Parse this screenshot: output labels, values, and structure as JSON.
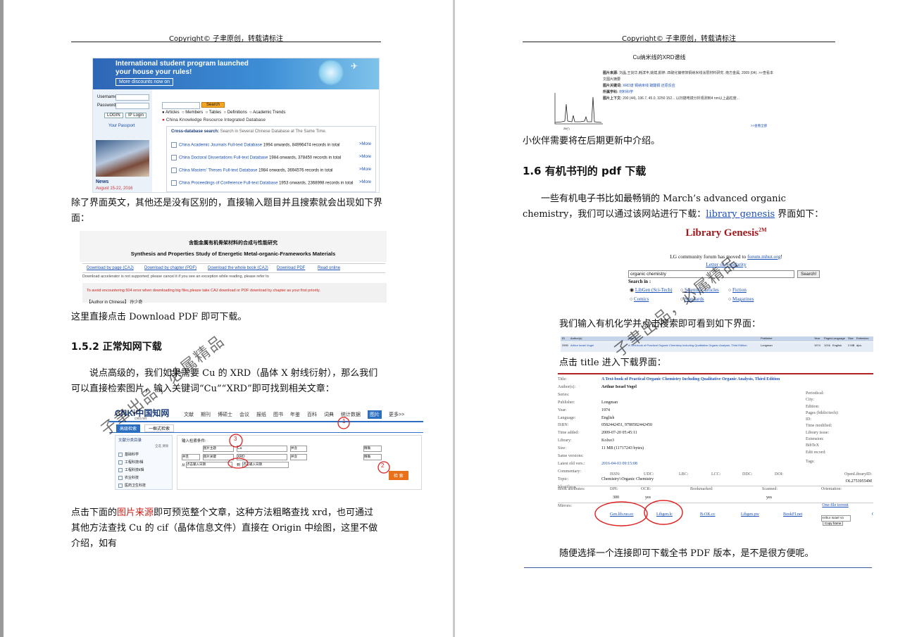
{
  "header": {
    "left": "Copyright© 子聿原创，转载请标注",
    "right": "Copyright© 子聿原创，转载请标注"
  },
  "watermark": {
    "left": "子聿出品，必属精品",
    "right": "子聿出品，必属精品"
  },
  "left": {
    "fig1": {
      "banner_title": "International student program launched",
      "banner_sub": "your house your rules!",
      "banner_btn": "More discounts now on",
      "username_label": "Username",
      "password_label": "Password",
      "login_btn": "LOGIN",
      "ip_login_btn": "IP Login",
      "passport": "Your Passport",
      "news": "News",
      "news_date": "August 15-22, 2016",
      "search_btn": "Search",
      "radios": [
        "Articles",
        "Members",
        "Tables",
        "Definitions",
        "Academic Trends"
      ],
      "section_title": "China Knowledge Resource Integrated Database",
      "cross_title": "Cross-database search:",
      "cross_desc": "Search in Several Chinese Database at The Same Time.",
      "rows": [
        {
          "name": "China Academic Journals Full-text Database",
          "info": "1994 onwards, 84996474 records in total",
          "more": ">More"
        },
        {
          "name": "China Doctoral Dissertations Full-text Database",
          "info": "1984 onwards, 378450 records in total",
          "more": ">More"
        },
        {
          "name": "China Masters' Theses Full-text Database",
          "info": "1984 onwards, 3694576 records in total",
          "more": ">More"
        },
        {
          "name": "China Proceedings of Conference Full-text Database",
          "info": "1953 onwards, 2368998 records in total",
          "more": ">More"
        }
      ]
    },
    "p1": "除了界面英文，其他还是没有区别的，直接输入题目并且搜索就会出现如下界面：",
    "fig2": {
      "title_cn": "含能金属有机骨架材料的合成与性能研究",
      "title_en": "Synthesis and Properties Study of Energetic Metal-organic-Frameworks Materials",
      "links": [
        "Download by page (CAJ)",
        "Download by chapter (PDF)",
        "Download the whole book (CAJ)",
        "Download PDF",
        "Read online"
      ],
      "note": "Download accelerator is not supported; please cancel it if you see an exception while reading, please refer to",
      "warning": "To avoid encountering 504 error when downloading big files,please take CAJ download or PDF download by chapter as your first priority.",
      "author": "【Author in Chinese】 孙少奇"
    },
    "p2": "这里直接点击 Download PDF 即可下载。",
    "h152": "1.5.2  正常知网下载",
    "p3": "说点高级的，我们如果需要 Cu 的 XRD（晶体 X 射线衍射），那么我们可以直接检索图片，输入关键词“Cu”“XRD”即可找到相关文章：",
    "fig3": {
      "logo": "CNKi中国知网",
      "logo_sub": "cnki.net",
      "nav": [
        "文献",
        "期刊",
        "博硕士",
        "会议",
        "报纸",
        "图书",
        "年鉴",
        "百科",
        "词典",
        "统计数据",
        "图片",
        "更多>>"
      ],
      "tab_active": "高级检索",
      "tab_other": "一框式检索",
      "left_title": "文献分类目录",
      "left_ops": "全选  清除",
      "cats": [
        "基础科学",
        "工程科技Ⅰ辑",
        "工程科技Ⅱ辑",
        "农业科技",
        "医药卫生科技"
      ],
      "input_label": "输入检索条件:",
      "field1": "图片主题",
      "value1": "Cu",
      "op1": "并含",
      "match1": "精确",
      "bool2": "并且",
      "field2": "图片关键",
      "value2": "XRD",
      "op2": "并含",
      "match2": "精确",
      "from_label": "从",
      "from_ph": "点击输入日期",
      "to_label": "到",
      "to_ph": "点击输入日期",
      "search": "检 索",
      "annot": [
        "1",
        "2",
        "3"
      ]
    },
    "p4_a": "点击下面的",
    "p4_red": "图片来源",
    "p4_b": "即可预览整个文章，这种方法粗略查找 xrd，也可通过 其他方法查找 Cu 的 cif（晶体信息文件）直接在 Origin 中绘图，这里不做介绍，如有"
  },
  "right": {
    "fig4": {
      "title": "Cu纳米线的XRD谱线",
      "labels": [
        "图片来源:",
        "图片关键词:",
        "所属学科:",
        "图片上下文:"
      ],
      "values": [
        "刘晶,王剑华,韩滨丰,姚斌,颜婷. 四硫化镍修饰铜纳米线涂层材料研究. 南方金属, 2009 (04).  >>查看本文图片摘要",
        "XRD谱  铜纳米线  硫酸铜  还原反应",
        "材料科学",
        "200 (44), 196.7, 45.0, 3250 152...  以扫描电镜分析观测到4 nm以上晶粒度..."
      ],
      "more": ">>查看全部",
      "xlabel": "2θ(°)",
      "ylabel": "Intensity",
      "peaks": [
        "Cu(111)",
        "Cu(200)",
        "Cu(220)",
        "Cu2O"
      ]
    },
    "p0": "小伙伴需要将在后期更新中介绍。",
    "h16": "1.6  有机书刊的 pdf 下载",
    "p1_a": "一些有机电子书比如最畅销的 March’s advanced organic chemistry，我们可以通过该网站进行下载：",
    "p1_link": "library genesis",
    "p1_b": " 界面如下：",
    "lg": {
      "title": "Library Genesis",
      "sup": "2M",
      "forum_pre": "LG community forum has moved to ",
      "forum_link": "forum.mhut.org",
      "forum_end": "!",
      "solidarity": "Letter of Solidarity",
      "search_value": "organic chemistry",
      "search_btn": "Search!",
      "search_in": "Search in :",
      "options": [
        "LibGen (Sci-Tech)",
        "Scientific articles",
        "Fiction",
        "Comics",
        "Standards",
        "Magazines"
      ]
    },
    "p2": "我们输入有机化学并点击搜索即可看到如下界面：",
    "res": {
      "headers": [
        "ID",
        "Author(s)",
        "Title",
        "Publisher",
        "Year",
        "Pages",
        "Language",
        "Size",
        "Extension"
      ],
      "row": [
        "2990",
        "Arthur Israel Vogel",
        "A Text-book of Practical Organic Chemistry Including Qualitative Organic Analysis, Third Edition",
        "Longman",
        "1974",
        "1216",
        "English",
        "2 MB",
        "djvu"
      ]
    },
    "p3": "点击 title 进入下载界面：",
    "detail": {
      "left_labels": [
        "Title:",
        "Author(s):",
        "Series:",
        "Publisher:",
        "Year:",
        "Language:",
        "ISBN:",
        "Time added:",
        "Library:",
        "Size:",
        "Same versions:",
        "Latest old vers.:",
        "Commentary:",
        "Topic:",
        "Identifiers:",
        "Book attributes:",
        "Mirrors:"
      ],
      "title": "A Text-book of Practical Organic Chemistry Including Qualitative Organic Analysis, Third Edition",
      "author": "Arthur Israel Vogel",
      "publisher": "Longman",
      "year": "1974",
      "language": "English",
      "isbn": "0582442451, 9780582442450",
      "time_added": "2009-07-20 05:45:11",
      "library": "Kolxo3",
      "size": "11 MB (11717243 bytes)",
      "old": "2016-04-03 09:15:08",
      "topic": "Chemistry\\\\Organic Chemistry",
      "right_labels": [
        "Periodical:",
        "City:",
        "Edition:",
        "Pages (biblio\\tech):",
        "ID:",
        "Time modified:",
        "Library issue:",
        "Extension:",
        "BibTeX",
        "Edit record:",
        "Tags:",
        "OpenLibraryID:"
      ],
      "olid": "OL27539554M",
      "ids": [
        "ISSN:",
        "UDC:",
        "LBC:",
        "LCC:",
        "DDC:",
        "DOI:"
      ],
      "attrs": [
        "DPI:",
        "OCR:",
        "Bookmarked:",
        "Scanned:",
        "Orientation:"
      ],
      "attr_vals": [
        "300",
        "yes",
        "yes"
      ],
      "mirrors": [
        "Gen.lib.rus.ec",
        "Libgen.lc",
        "B-OK.cc",
        "Libgen.pw",
        "BookFI.net",
        "One-file torrent"
      ],
      "author_box": "Arthur Israel Vo",
      "copy_btn": "Copy frame"
    },
    "p4": "随便选择一个连接即可下载全书 PDF 版本，是不是很方便呢。"
  }
}
